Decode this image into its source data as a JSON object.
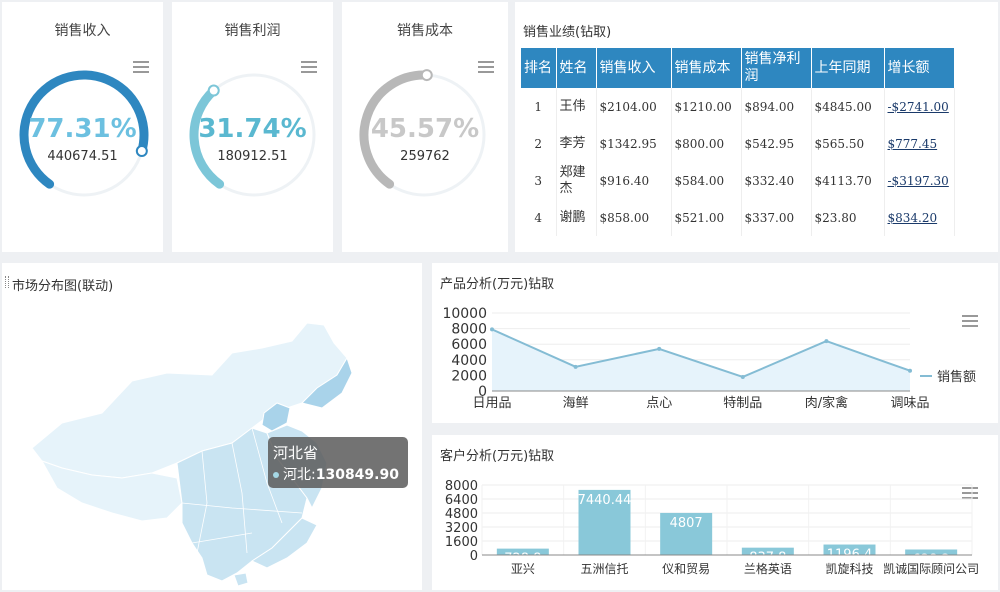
{
  "gauges": [
    {
      "title": "销售收入",
      "percent": "77.31%",
      "fraction": 0.7731,
      "value": "440674.51",
      "color": "#2e87c0",
      "text_color": "#6cc0e0"
    },
    {
      "title": "销售利润",
      "percent": "31.74%",
      "fraction": 0.3174,
      "value": "180912.51",
      "color": "#7cc6d8",
      "text_color": "#5ab8d0"
    },
    {
      "title": "销售成本",
      "percent": "45.57%",
      "fraction": 0.4557,
      "value": "259762",
      "color": "#b8b8b8",
      "text_color": "#c8c8c8"
    }
  ],
  "ranking": {
    "title": "销售业绩(钻取)",
    "headers": [
      "排名",
      "姓名",
      "销售收入",
      "销售成本",
      "销售净利润",
      "上年同期",
      "增长额"
    ],
    "rows": [
      [
        "1",
        "王伟",
        "$2104.00",
        "$1210.00",
        "$894.00",
        "$4845.00",
        "-$2741.00"
      ],
      [
        "2",
        "李芳",
        "$1342.95",
        "$800.00",
        "$542.95",
        "$565.50",
        "$777.45"
      ],
      [
        "3",
        "郑建杰",
        "$916.40",
        "$584.00",
        "$332.40",
        "$4113.70",
        "-$3197.30"
      ],
      [
        "4",
        "谢鹏",
        "$858.00",
        "$521.00",
        "$337.00",
        "$23.80",
        "$834.20"
      ]
    ]
  },
  "map": {
    "title": "市场分布图(联动)",
    "tooltip_title": "河北省",
    "tooltip_label": "河北:",
    "tooltip_value": "130849.90"
  },
  "chart_data": [
    {
      "type": "area",
      "title": "产品分析(万元)钻取",
      "categories": [
        "日用品",
        "海鲜",
        "点心",
        "特制品",
        "肉/家禽",
        "调味品"
      ],
      "series": [
        {
          "name": "销售额",
          "values": [
            7900,
            3100,
            5400,
            1800,
            6400,
            2600
          ]
        }
      ],
      "yticks": [
        "10000",
        "8000",
        "6000",
        "4000",
        "2000",
        "0"
      ],
      "ylim": [
        0,
        10000
      ],
      "legend": "right",
      "color": "#84bcd4",
      "fill": "#e6f3fb"
    },
    {
      "type": "bar",
      "title": "客户分析(万元)钻取",
      "categories": [
        "亚兴",
        "五洲信托",
        "仪和贸易",
        "兰格英语",
        "凯旋科技",
        "凯诚国际顾问公司"
      ],
      "values": [
        728.8,
        7440.44,
        4807,
        837.8,
        1196.4,
        628.2
      ],
      "labels": [
        "728.8",
        "7440.44",
        "4807",
        "837.8",
        "1196.4",
        "628.2"
      ],
      "yticks": [
        "8000",
        "6400",
        "4800",
        "3200",
        "1600",
        "0"
      ],
      "ylim": [
        0,
        8000
      ],
      "color": "#89c8d9"
    }
  ],
  "icons": {
    "menu": "hamburger-menu-icon"
  }
}
